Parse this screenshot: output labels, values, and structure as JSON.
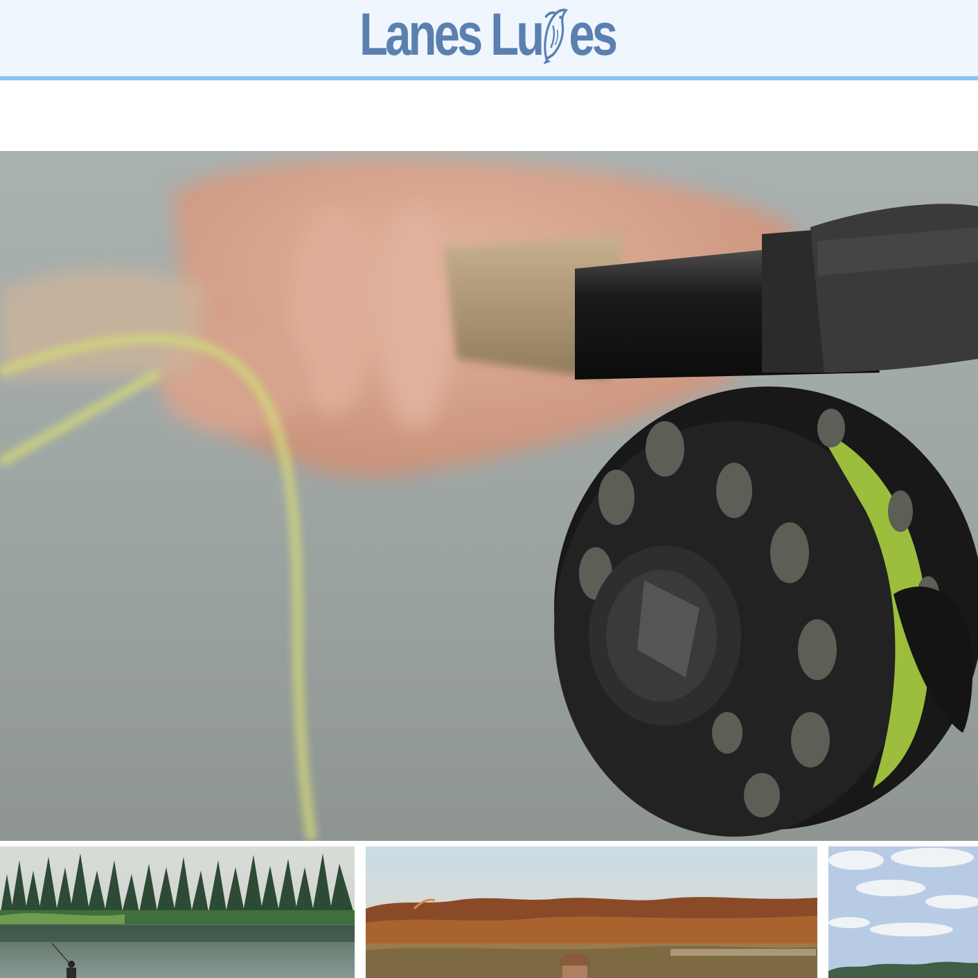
{
  "header": {
    "logo_text_left": "Lanes Lu",
    "logo_text_right": "es",
    "logo_icon": "fish-icon"
  },
  "hero": {
    "image": "fly-fishing-reel-photo",
    "slides": [
      {
        "active": true
      },
      {
        "active": false
      }
    ]
  },
  "gallery": [
    {
      "image": "lake-forest-angler-photo"
    },
    {
      "image": "sunset-field-angler-photo"
    },
    {
      "image": "cloudy-sky-shoreline-photo"
    }
  ],
  "colors": {
    "header_bg": "#f0f6fd",
    "header_border": "#8cc4f3",
    "logo": "#5a80b0"
  }
}
